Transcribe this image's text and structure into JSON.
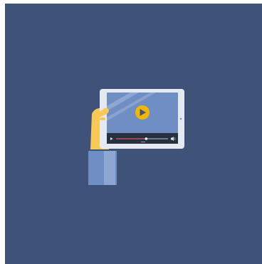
{
  "scene": {
    "background_color": "#3f5378",
    "video_progress": 0.58,
    "colors": {
      "tablet_frame": "#e4e9f2",
      "screen": "#6f8ec4",
      "controls_bar": "#26303f",
      "play_button": "#f2b705",
      "progress_played": "#c94a4a",
      "progress_remaining": "#9aa7bd",
      "hand": "#f8c955",
      "sleeve": "#6f8ec4",
      "sleeve_highlight": "#8da7d2"
    },
    "icons": [
      "play-circle-icon",
      "play-small-icon",
      "volume-icon"
    ]
  }
}
